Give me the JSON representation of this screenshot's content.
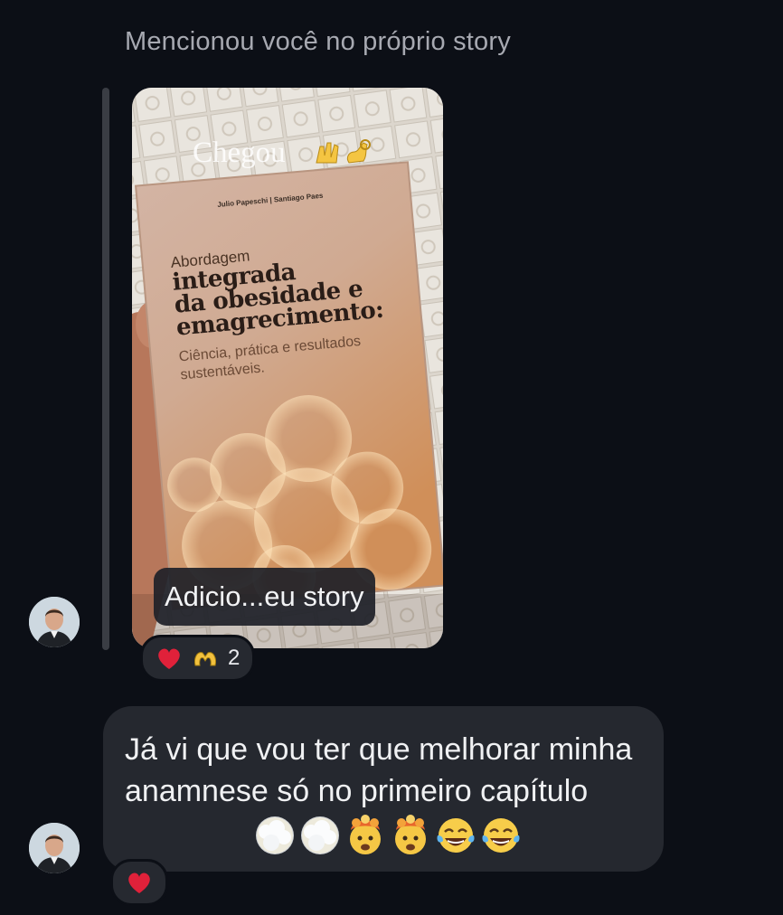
{
  "header": {
    "mention_text": "Mencionou você no próprio story"
  },
  "story": {
    "overlay_text": "Chegou",
    "overlay_emoji": [
      "raising-hands-icon",
      "ok-hand-icon"
    ],
    "book": {
      "authors": "Julio Papeschi | Santiago Paes",
      "line1": "Abordagem",
      "line2": "integrada",
      "line3": "da obesidade e",
      "line4": "emagrecimento:",
      "subtitle": "Ciência, prática e resultados sustentáveis."
    },
    "label": "Adicio...eu story"
  },
  "story_reactions": {
    "icons": [
      "red-heart-icon",
      "heart-hands-icon"
    ],
    "count": "2"
  },
  "message": {
    "text": "Já vi que vou ter que melhorar minha anamnese só no primeiro capítulo",
    "emojis": [
      "fog-face-icon",
      "fog-face-icon",
      "exploding-head-icon",
      "exploding-head-icon",
      "tears-of-joy-icon",
      "tears-of-joy-icon"
    ],
    "reaction": "red-heart-icon"
  },
  "colors": {
    "background": "#0c0f16",
    "bubble": "#25282f",
    "muted_text": "#a7a9b1",
    "heart": "#e0213a"
  }
}
